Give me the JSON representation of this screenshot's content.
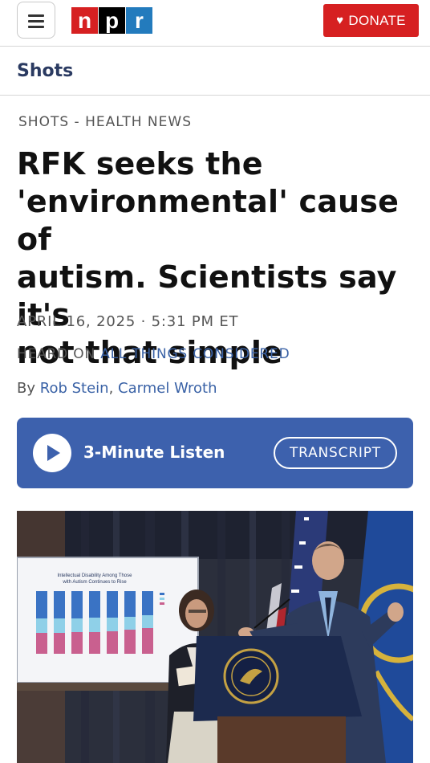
{
  "header": {
    "logo_letters": [
      "n",
      "p",
      "r"
    ],
    "donate_label": "DONATE",
    "colors": {
      "npr_red": "#d62021",
      "npr_black": "#000000",
      "npr_blue": "#237bbd"
    }
  },
  "section": {
    "title": "Shots"
  },
  "article": {
    "kicker": "SHOTS - HEALTH NEWS",
    "headline_lines": [
      "RFK seeks the",
      "'environmental' cause of",
      "autism. Scientists say it's",
      "not that simple"
    ],
    "date": "APRIL 16, 2025",
    "time": "5:31 PM ET",
    "heard_on_prefix": "HEARD ON",
    "heard_on_program": "ALL THINGS CONSIDERED",
    "byline_prefix": "By",
    "authors": [
      "Rob Stein",
      "Carmel Wroth"
    ]
  },
  "player": {
    "listen_label": "3-Minute Listen",
    "transcript_label": "TRANSCRIPT",
    "color": "#3d61ad"
  },
  "photo": {
    "screen_chart_title": "Intellectual Disability Among Those with Autism Continues to Rise"
  }
}
